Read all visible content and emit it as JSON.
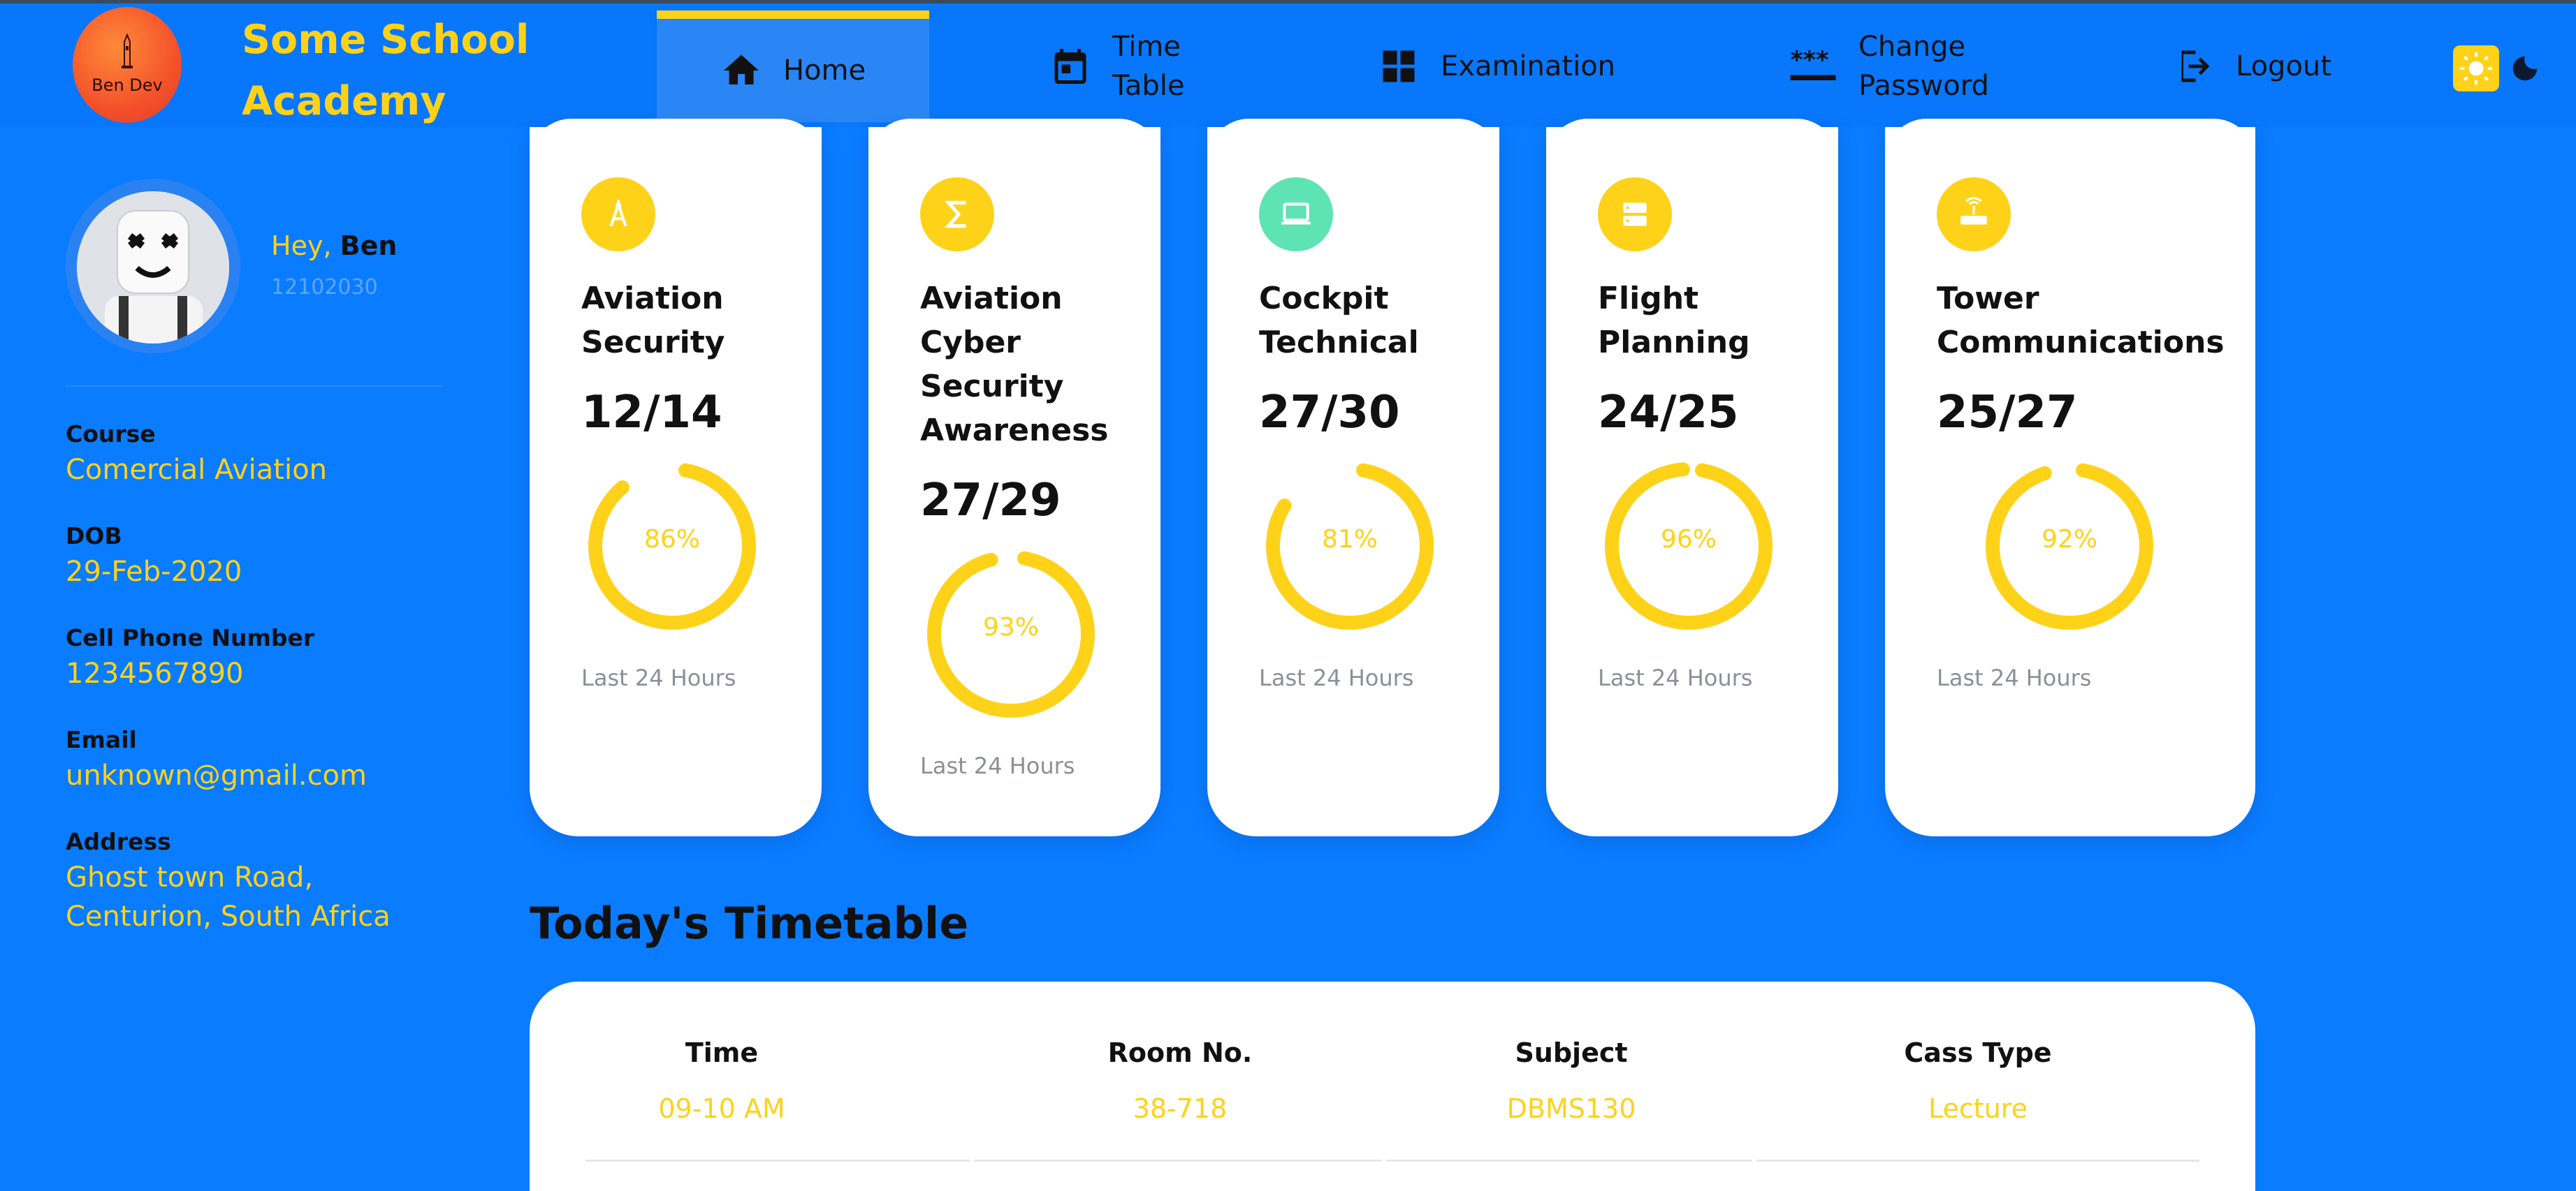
{
  "header": {
    "logo_text": "Ben Dev",
    "brand_title": "Some School\nAcademy",
    "nav": [
      {
        "label": "Home",
        "icon": "home-icon"
      },
      {
        "label": "Time\nTable",
        "icon": "calendar-icon"
      },
      {
        "label": "Examination",
        "icon": "dashboard-icon"
      },
      {
        "label": "Change\nPassword",
        "icon": "password-icon"
      },
      {
        "label": "Logout",
        "icon": "logout-icon"
      }
    ]
  },
  "profile": {
    "greeting": "Hey,",
    "name": "Ben",
    "student_id": "12102030",
    "fields": [
      {
        "label": "Course",
        "value": "Comercial Aviation"
      },
      {
        "label": "DOB",
        "value": "29-Feb-2020"
      },
      {
        "label": "Cell Phone Number",
        "value": "1234567890"
      },
      {
        "label": "Email",
        "value": "unknown@gmail.com"
      },
      {
        "label": "Address",
        "value": "Ghost town Road, Centurion, South Africa"
      }
    ]
  },
  "courses": [
    {
      "title": "Aviation Security",
      "score": "12/14",
      "percent": 86,
      "percent_label": "86%",
      "footer": "Last 24 Hours",
      "icon": "compass-icon"
    },
    {
      "title": "Aviation Cyber Security Awareness",
      "score": "27/29",
      "percent": 93,
      "percent_label": "93%",
      "footer": "Last 24 Hours",
      "icon": "sigma-icon"
    },
    {
      "title": "Cockpit Technical",
      "score": "27/30",
      "percent": 81,
      "percent_label": "81%",
      "footer": "Last 24 Hours",
      "icon": "laptop-icon"
    },
    {
      "title": "Flight Planning",
      "score": "24/25",
      "percent": 96,
      "percent_label": "96%",
      "footer": "Last 24 Hours",
      "icon": "server-icon"
    },
    {
      "title": "Tower Communications",
      "score": "25/27",
      "percent": 92,
      "percent_label": "92%",
      "footer": "Last 24 Hours",
      "icon": "router-icon"
    }
  ],
  "timetable": {
    "title": "Today's Timetable",
    "columns": [
      "Time",
      "Room No.",
      "Subject",
      "Cass Type"
    ],
    "rows": [
      [
        "09-10 AM",
        "38-718",
        "DBMS130",
        "Lecture"
      ]
    ]
  },
  "colors": {
    "accent": "#ffd21a",
    "background": "#0a7cff",
    "ring": "#ffd21a"
  }
}
